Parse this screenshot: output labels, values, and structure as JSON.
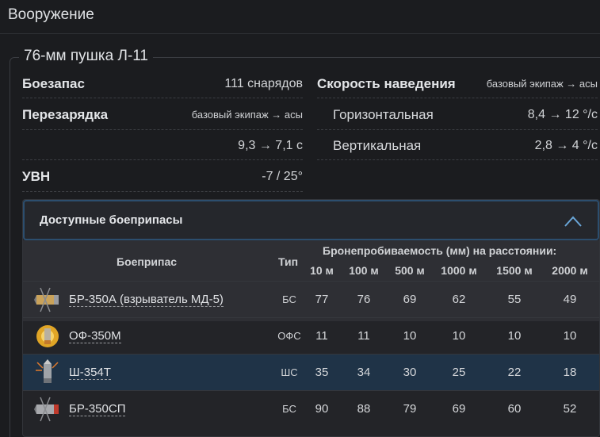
{
  "section": {
    "title": "Вооружение"
  },
  "gun": {
    "name": "76-мм пушка Л-11",
    "ammo_label": "Боезапас",
    "ammo_value": "111 снарядов",
    "reload_label": "Перезарядка",
    "reload_note": "базовый экипаж → асы",
    "reload_value": "9,3 → 7,1 с",
    "uvn_label": "УВН",
    "uvn_value": "-7 / 25°",
    "aim_label": "Скорость наведения",
    "aim_note": "базовый экипаж → асы",
    "horiz_label": "Горизонтальная",
    "horiz_value": "8,4 → 12 °/с",
    "vert_label": "Вертикальная",
    "vert_value": "2,8 → 4 °/с"
  },
  "ammo_panel": {
    "title": "Доступные боеприпасы",
    "expanded_icon": "chevron-up-icon",
    "accent": "#2c4e6e"
  },
  "table": {
    "col_ammo": "Боеприпас",
    "col_type": "Тип",
    "col_penetration": "Бронепробиваемость (мм) на расстоянии:",
    "distances": [
      "10 м",
      "100 м",
      "500 м",
      "1000 м",
      "1500 м",
      "2000 м"
    ],
    "rows": [
      {
        "name": "БР-350А (взрыватель МД-5)",
        "type": "БС",
        "values": [
          "77",
          "76",
          "69",
          "62",
          "55",
          "49"
        ],
        "icon": "ap-shell-icon",
        "highlight": false
      },
      {
        "name": "ОФ-350М",
        "type": "ОФС",
        "values": [
          "11",
          "11",
          "10",
          "10",
          "10",
          "10"
        ],
        "icon": "he-shell-icon",
        "highlight": false
      },
      {
        "name": "Ш-354Т",
        "type": "ШС",
        "values": [
          "35",
          "34",
          "30",
          "25",
          "22",
          "18"
        ],
        "icon": "shrapnel-shell-icon",
        "highlight": true
      },
      {
        "name": "БР-350СП",
        "type": "БС",
        "values": [
          "90",
          "88",
          "79",
          "69",
          "60",
          "52"
        ],
        "icon": "solid-ap-shell-icon",
        "highlight": false
      }
    ]
  }
}
